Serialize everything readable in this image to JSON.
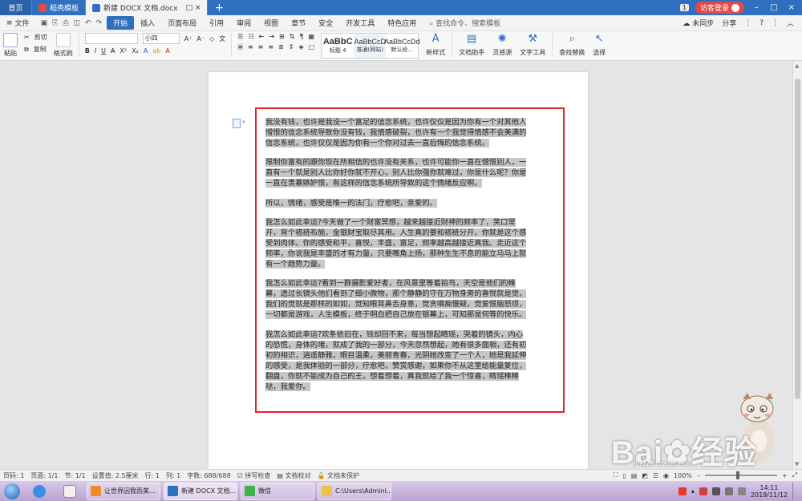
{
  "tabs": {
    "home": "首页",
    "template": "稻壳模板",
    "doc": "新建 DOCX 文档.docx",
    "badge": "1",
    "login": "访客登录"
  },
  "menu": {
    "file": "文件",
    "items": [
      "开始",
      "插入",
      "页面布局",
      "引用",
      "审阅",
      "视图",
      "章节",
      "安全",
      "开发工具",
      "特色应用"
    ],
    "search": "查找命令、搜索模板",
    "sync": "未同步",
    "share": "分享",
    "help": "?"
  },
  "ribbon": {
    "paste": "粘贴",
    "cut": "剪切",
    "copy": "复制",
    "format_painter": "格式刷",
    "font_name": "",
    "font_size": "小四",
    "styles": [
      {
        "sample": "AaBbC",
        "name": "标题 4"
      },
      {
        "sample": "AaBbCcD",
        "name": "普通(网站)"
      },
      {
        "sample": "AaBbCcDd",
        "name": "默认段..."
      }
    ],
    "new_style": "新样式",
    "doc_assistant": "文档助手",
    "inspiration": "灵感源",
    "text_tools": "文字工具",
    "find_replace": "查找替换",
    "select": "选择"
  },
  "document": {
    "paragraphs": [
      "我没有钱，也许是我设一个富足的信念系统，也许仅仅是因为你有一个对其他人憎恨的信念系统导致你没有钱，我情感破裂，也许有一个我觉得情感不会美满的信念系统，也许仅仅是因为你有一个你对过去一直后悔的信念系统。",
      "限制你富有的跟你现在所相信的也许没有关系，也许可能你一直在憎恨别人，一直有一个就是别人比你好你就不开心，别人比你强你就难过，你是什么呢？你是一直在羡慕嫉妒恨，有这样的信念系统所导致的这个情绪反应啊。",
      "所以，情绪，感受是唯一的法门，疗愈吧，亲爱的。",
      "我怎么如此幸运?今天做了一个财富冥想，越来越接近财神的频率了，笑口常开，背个褡裢布施，金银财宝取尽其用。人生真的要和褡裢分开。你就是这个感受到肉体。你的感受和平，喜悦，丰盛，富足，频率越高越接近真我。走近这个频率，你说我是丰盛的才有力量，只要嘴角上扬，那种生生不息的能立马马上就有一个趋势力量。",
      "我怎么如此幸运?看到一群摄影爱好者，在风景里等着拍鸟，天空是他们的帷幕，透过长镜头他们看到了细小微物，那个静静的守在万物身旁的喜悦就是觉，我们的觉就是那样的如如，觉知眼耳鼻舌身意，觉贪嗔痴慢疑，觉爱恨脑怒烦，一切都是游戏，人生模板，终于明白把自己放在银幕上，可知那是何等的快乐。",
      "我怎么如此幸运?欢条依旧在，钱却回不来，每当想起睛瑶，哭着的镜头，内心的恐慌，身体的堵，就成了我的一部分，今天忽然想起，她有很多面相，还有初初的相识，逍遥静雅，眼目温柔，美丽青春，光阴她改变了一个人，她是我延伸的感受，是我体验的一部分，疗愈吧，赞赏感谢，如果你不从这里给能量复位，翻盘，你就不能成为自己的王，想着想着，真我就给了我一个惊喜，睛瑶棒棒哒，我爱你。"
    ]
  },
  "status": {
    "page": "页码: 1",
    "pages": "页面: 1/1",
    "section": "节: 1/1",
    "setting": "设置值: 2.5厘米",
    "row": "行: 1",
    "col": "列: 1",
    "words": "字数: 688/688",
    "spell": "拼写检查",
    "proof": "文档校对",
    "unprotected": "文档未保护",
    "zoom": "100%",
    "zoom_value": 0.45
  },
  "taskbar": {
    "tasks": [
      "让世界因我而美...",
      "新建 DOCX 文档...",
      "微信",
      "C:\\Users\\Admini..."
    ],
    "time": "14:11",
    "date": "2019/11/12"
  },
  "watermark": {
    "brand": "Bai",
    "brand2": "经验",
    "url": "jingyan.baidu.com"
  }
}
